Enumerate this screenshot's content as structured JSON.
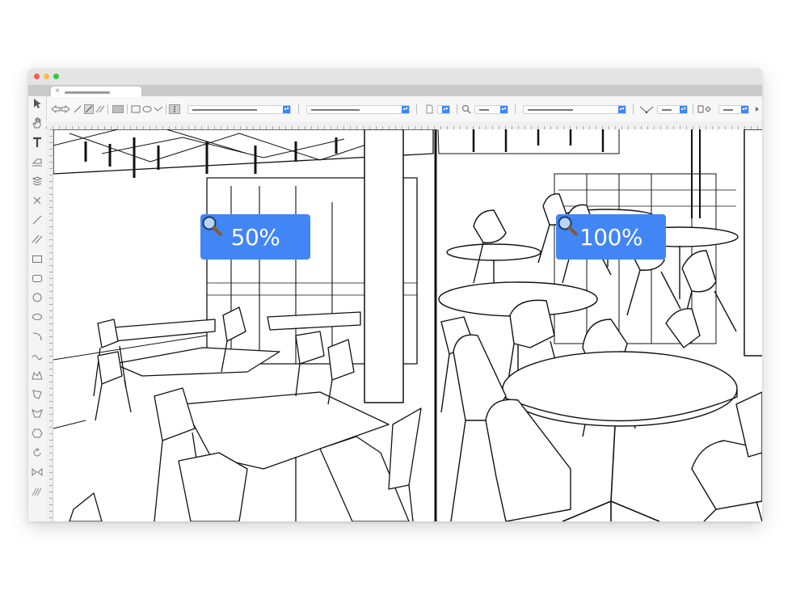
{
  "window": {
    "traffic_lights": {
      "close": "#fc5753",
      "minimize": "#fdbc40",
      "maximize": "#33c748"
    }
  },
  "tab": {
    "close_glyph": "×"
  },
  "canvas": {
    "left_view": {
      "zoom_label": "50%",
      "icon": "magnifier-icon"
    },
    "right_view": {
      "zoom_label": "100%",
      "icon": "magnifier-icon"
    },
    "accent_color": "#4285f4"
  }
}
